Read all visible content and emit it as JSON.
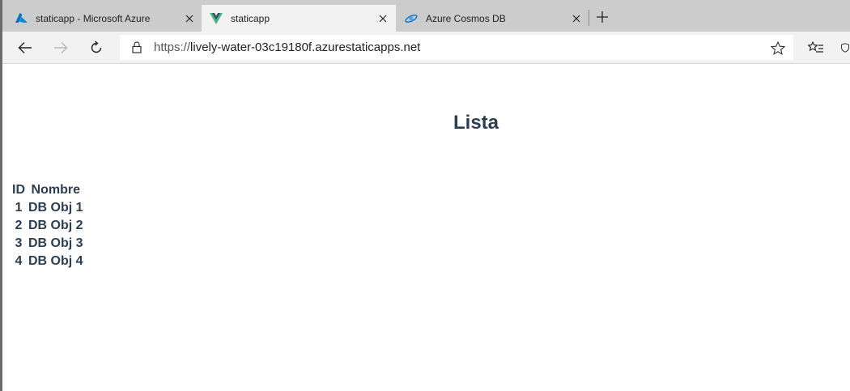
{
  "browser": {
    "tabs": [
      {
        "title": "staticapp - Microsoft Azure",
        "icon": "azure-logo-icon",
        "active": false
      },
      {
        "title": "staticapp",
        "icon": "vue-logo-icon",
        "active": true
      },
      {
        "title": "Azure Cosmos DB",
        "icon": "cosmos-db-icon",
        "active": false
      }
    ],
    "address": {
      "scheme": "https://",
      "host": "lively-water-03c19180f.azurestaticapps.net"
    }
  },
  "page": {
    "title": "Lista",
    "table": {
      "headers": [
        "ID",
        "Nombre"
      ],
      "rows": [
        {
          "id": "1",
          "nombre": "DB Obj 1"
        },
        {
          "id": "2",
          "nombre": "DB Obj 2"
        },
        {
          "id": "3",
          "nombre": "DB Obj 3"
        },
        {
          "id": "4",
          "nombre": "DB Obj 4"
        }
      ]
    }
  },
  "colors": {
    "text": "#2c3e50",
    "tabstrip": "#cccccc",
    "toolbar": "#f2f2f2",
    "azure_blue": "#0072c6",
    "vue_green": "#41b883",
    "vue_dark": "#35495e"
  }
}
